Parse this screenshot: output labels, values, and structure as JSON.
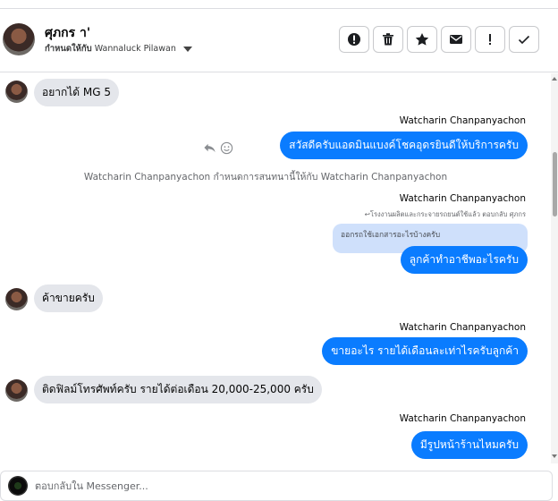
{
  "header": {
    "contact_name": "ศุภกร า'",
    "assigned_label": "กำหนดให้กับ",
    "assigned_to": "Wannaluck Pilawan",
    "actions": [
      {
        "icon": "alert-circle-icon",
        "name": "spam-button"
      },
      {
        "icon": "trash-icon",
        "name": "delete-button"
      },
      {
        "icon": "star-icon",
        "name": "star-button"
      },
      {
        "icon": "envelope-icon",
        "name": "mark-unread-button"
      },
      {
        "icon": "exclamation-icon",
        "name": "follow-up-button"
      },
      {
        "icon": "checkmark-icon",
        "name": "mark-done-button"
      }
    ]
  },
  "messages": {
    "m1_text": "อยากได้ MG 5",
    "m2_sender": "Watcharin Chanpanyachon",
    "m2_text": "สวัสดีครับแอดมินแบงค์โชคอุดรยินดีให้บริการครับ",
    "system_note": "Watcharin Chanpanyachon กำหนดการสนทนานี้ให้กับ Watcharin Chanpanyachon",
    "m3_sender": "Watcharin Chanpanyachon",
    "m3_reply_note": "↩โรงงานผลิตและกระจายรถยนต์ใช้แล้ว ตอบกลับ ศุภกร",
    "m3_quoted": "ออกรถใช้เอกสารอะไรบ้างครับ",
    "m3_text": "ลูกค้าทำอาชีพอะไรครับ",
    "m4_text": "ค้าขายครับ",
    "m5_sender": "Watcharin Chanpanyachon",
    "m5_text": "ขายอะไร รายได้เดือนละเท่าไรครับลูกค้า",
    "m6_text": "ติดฟิลม์โทรศัพท์ครับ รายได้ต่อเดือน 20,000-25,000 ครับ",
    "m7_sender": "Watcharin Chanpanyachon",
    "m7_text": "มีรูปหน้าร้านไหมครับ"
  },
  "composer": {
    "placeholder": "ตอบกลับใน Messenger..."
  },
  "colors": {
    "outgoing_bubble": "#0a7cff",
    "incoming_bubble": "#e4e6eb",
    "quoted_bubble": "#cfe0fb"
  }
}
